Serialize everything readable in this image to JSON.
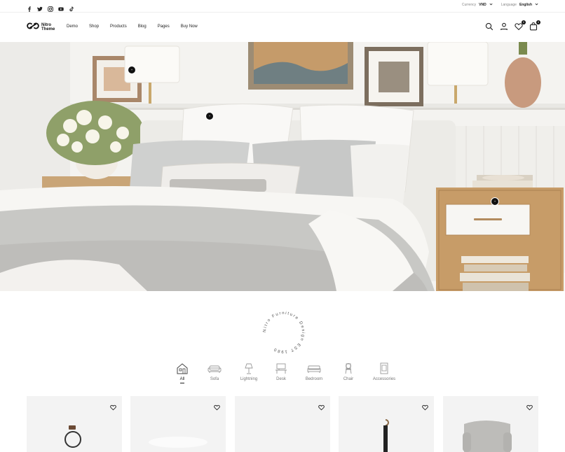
{
  "topbar": {
    "social_icons": [
      "facebook-icon",
      "twitter-icon",
      "instagram-icon",
      "youtube-icon",
      "tiktok-icon"
    ],
    "currency_label": "Currency",
    "currency_value": "VND",
    "language_label": "Language",
    "language_value": "English"
  },
  "header": {
    "logo_line1": "Nitro",
    "logo_line2": "Theme",
    "nav": [
      "Demo",
      "Shop",
      "Products",
      "Blog",
      "Pages",
      "Buy Now"
    ],
    "wishlist_count": "0",
    "cart_count": "0"
  },
  "hero": {
    "hotspot_label": "+"
  },
  "stamp": {
    "text": "Nitro Furniture Design EST 1980"
  },
  "categories": [
    {
      "label": "All",
      "icon": "house-icon",
      "active": true
    },
    {
      "label": "Sofa",
      "icon": "sofa-icon"
    },
    {
      "label": "Lightning",
      "icon": "lamp-icon"
    },
    {
      "label": "Desk",
      "icon": "desk-icon"
    },
    {
      "label": "Bedroom",
      "icon": "bed-icon"
    },
    {
      "label": "Chair",
      "icon": "chair-icon"
    },
    {
      "label": "Accessories",
      "icon": "frame-icon"
    }
  ],
  "products": [
    {
      "icon": "wishlist-heart-icon"
    },
    {
      "icon": "wishlist-heart-icon"
    },
    {
      "icon": "wishlist-heart-icon"
    },
    {
      "icon": "wishlist-heart-icon"
    },
    {
      "icon": "wishlist-heart-icon"
    }
  ],
  "colors": {
    "accent": "#111111",
    "muted_text": "#777777",
    "card_bg": "#f3f3f3"
  }
}
